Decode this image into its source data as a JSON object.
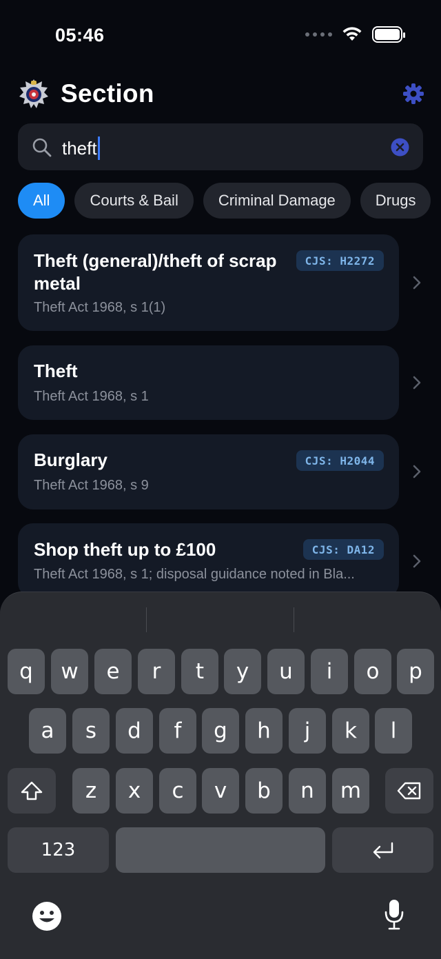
{
  "status_bar": {
    "time": "05:46"
  },
  "header": {
    "title": "Section"
  },
  "search": {
    "value": "theft"
  },
  "chips": [
    "All",
    "Courts & Bail",
    "Criminal Damage",
    "Drugs"
  ],
  "results": [
    {
      "title": "Theft (general)/theft of scrap metal",
      "subtitle": "Theft Act 1968, s 1(1)",
      "cjs": "CJS: H2272"
    },
    {
      "title": "Theft",
      "subtitle": "Theft Act 1968, s 1",
      "cjs": ""
    },
    {
      "title": "Burglary",
      "subtitle": "Theft Act 1968, s 9",
      "cjs": "CJS: H2044"
    },
    {
      "title": "Shop theft up to £100",
      "subtitle": "Theft Act 1968, s 1; disposal guidance noted in Bla...",
      "cjs": "CJS: DA12"
    }
  ],
  "keyboard": {
    "row1": [
      "q",
      "w",
      "e",
      "r",
      "t",
      "y",
      "u",
      "i",
      "o",
      "p"
    ],
    "row2": [
      "a",
      "s",
      "d",
      "f",
      "g",
      "h",
      "j",
      "k",
      "l"
    ],
    "row3": [
      "z",
      "x",
      "c",
      "v",
      "b",
      "n",
      "m"
    ],
    "numbers_label": "123"
  },
  "colors": {
    "accent": "#1e8cf5",
    "background": "#07090f",
    "card": "#141a26",
    "cjs_text": "#7fb6ea",
    "gear": "#3d4fc4"
  },
  "icons": {
    "logo": "police-crest-icon",
    "settings": "gear-icon",
    "search": "search-icon",
    "clear": "clear-icon",
    "chevron": "chevron-right-icon",
    "shift": "shift-icon",
    "delete": "delete-icon",
    "return": "return-icon",
    "emoji": "emoji-icon",
    "mic": "microphone-icon"
  }
}
